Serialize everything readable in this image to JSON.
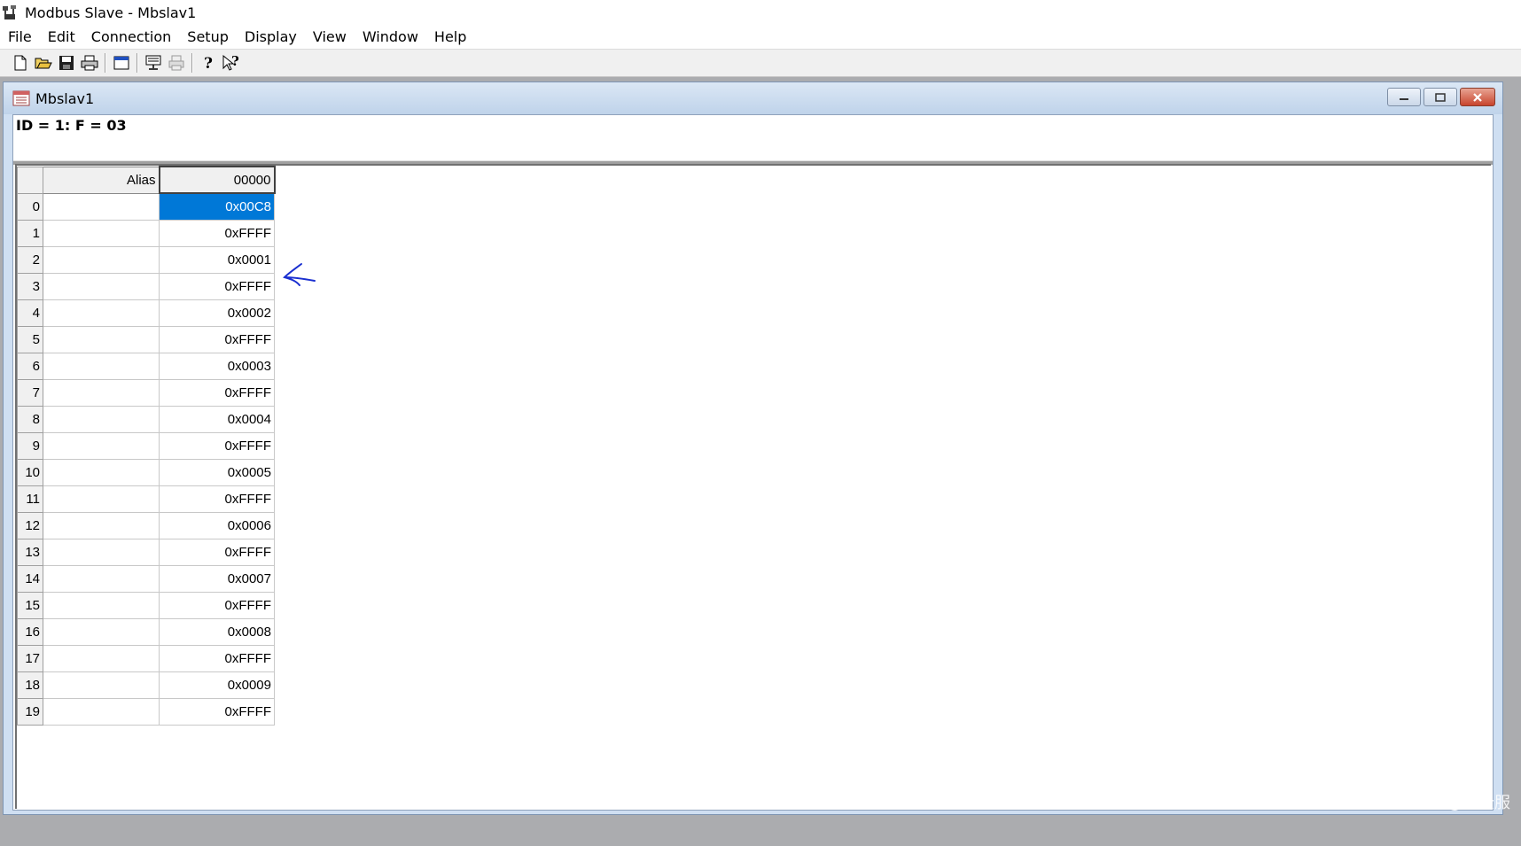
{
  "window": {
    "title": "Modbus Slave - Mbslav1"
  },
  "menu": [
    "File",
    "Edit",
    "Connection",
    "Setup",
    "Display",
    "View",
    "Window",
    "Help"
  ],
  "toolbar": {
    "buttons": [
      "new-icon",
      "open-icon",
      "save-icon",
      "print-icon",
      "window-icon",
      "monitor-icon",
      "printer-disabled-icon",
      "help-icon",
      "context-help-icon"
    ]
  },
  "child_window": {
    "title": "Mbslav1",
    "info": "ID = 1: F = 03"
  },
  "grid": {
    "alias_header": "Alias",
    "value_header": "00000",
    "rows": [
      {
        "num": "0",
        "value": "0x00C8",
        "selected": true
      },
      {
        "num": "1",
        "value": "0xFFFF"
      },
      {
        "num": "2",
        "value": "0x0001"
      },
      {
        "num": "3",
        "value": "0xFFFF"
      },
      {
        "num": "4",
        "value": "0x0002"
      },
      {
        "num": "5",
        "value": "0xFFFF"
      },
      {
        "num": "6",
        "value": "0x0003"
      },
      {
        "num": "7",
        "value": "0xFFFF"
      },
      {
        "num": "8",
        "value": "0x0004"
      },
      {
        "num": "9",
        "value": "0xFFFF"
      },
      {
        "num": "10",
        "value": "0x0005"
      },
      {
        "num": "11",
        "value": "0xFFFF"
      },
      {
        "num": "12",
        "value": "0x0006"
      },
      {
        "num": "13",
        "value": "0xFFFF"
      },
      {
        "num": "14",
        "value": "0x0007"
      },
      {
        "num": "15",
        "value": "0xFFFF"
      },
      {
        "num": "16",
        "value": "0x0008"
      },
      {
        "num": "17",
        "value": "0xFFFF"
      },
      {
        "num": "18",
        "value": "0x0009"
      },
      {
        "num": "19",
        "value": "0xFFFF"
      }
    ]
  },
  "annotation": {
    "arrow_color": "#1a2fd0"
  },
  "watermark": "CSDN @智云服",
  "colors": {
    "selection": "#0078d7",
    "mdi_background": "#abacaf"
  }
}
